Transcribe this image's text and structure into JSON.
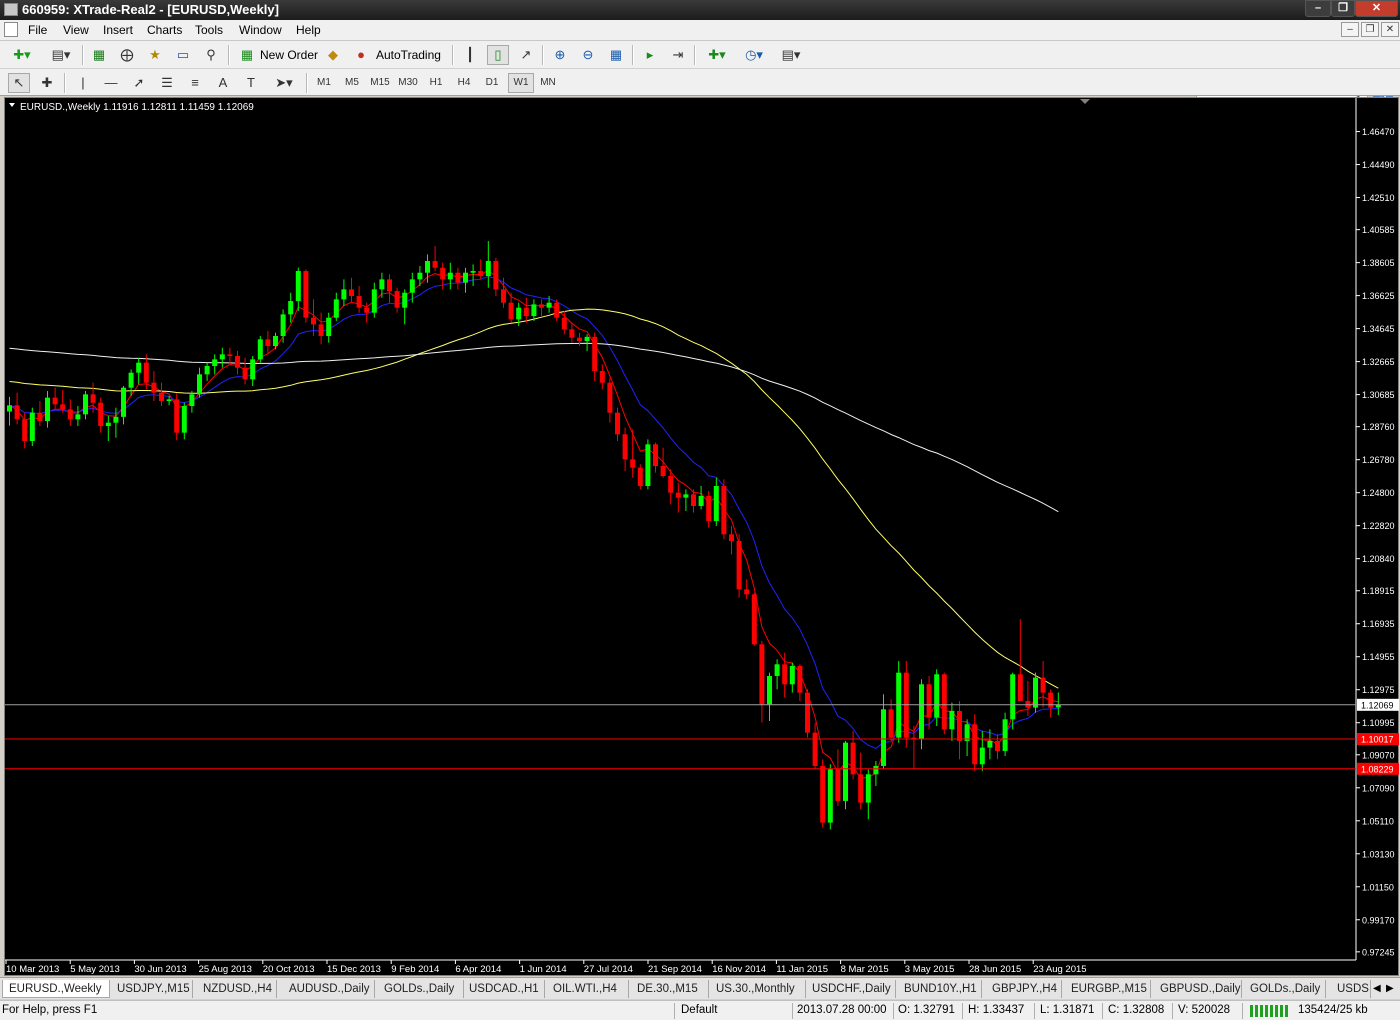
{
  "window": {
    "title": "660959: XTrade-Real2 - [EURUSD,Weekly]"
  },
  "menu": {
    "items": [
      "File",
      "View",
      "Insert",
      "Charts",
      "Tools",
      "Window",
      "Help"
    ]
  },
  "toolbar": {
    "new_order_label": "New Order",
    "autotrading_label": "AutoTrading"
  },
  "timeframes": [
    "M1",
    "M5",
    "M15",
    "M30",
    "H1",
    "H4",
    "D1",
    "W1",
    "MN"
  ],
  "active_timeframe": "W1",
  "chart": {
    "header": "EURUSD.,Weekly  1.11916 1.12811 1.11459 1.12069",
    "background": "#000000",
    "bull_color": "#00ff00",
    "bear_color": "#ff0000"
  },
  "chart_data": {
    "type": "candlestick",
    "symbol": "EURUSD.",
    "timeframe": "Weekly",
    "last_bar": {
      "open": 1.11916,
      "high": 1.12811,
      "low": 1.11459,
      "close": 1.12069
    },
    "y_ticks": [
      "1.46470",
      "1.44490",
      "1.42510",
      "1.40585",
      "1.38605",
      "1.36625",
      "1.34645",
      "1.32665",
      "1.30685",
      "1.28760",
      "1.26780",
      "1.24800",
      "1.22820",
      "1.20840",
      "1.18915",
      "1.16935",
      "1.14955",
      "1.12975",
      "1.10995",
      "1.09070",
      "1.07090",
      "1.05110",
      "1.03130",
      "1.01150",
      "0.99170",
      "0.97245"
    ],
    "ylim": [
      0.96815,
      1.48484
    ],
    "x_ticks": [
      "10 Mar 2013",
      "5 May 2013",
      "30 Jun 2013",
      "25 Aug 2013",
      "20 Oct 2013",
      "15 Dec 2013",
      "9 Feb 2014",
      "6 Apr 2014",
      "1 Jun 2014",
      "27 Jul 2014",
      "21 Sep 2014",
      "16 Nov 2014",
      "11 Jan 2015",
      "8 Mar 2015",
      "3 May 2015",
      "28 Jun 2015",
      "23 Aug 2015"
    ],
    "price_lines": [
      {
        "value": "1.12069",
        "color": "#a0a0a0",
        "label_bg": "#ffffff",
        "label_color": "#000000"
      },
      {
        "value": "1.10017",
        "color": "#ff0000",
        "label_bg": "#ff0000",
        "label_color": "#ffffff"
      },
      {
        "value": "1.08229",
        "color": "#ff0000",
        "label_bg": "#ff0000",
        "label_color": "#ffffff"
      }
    ],
    "moving_averages": [
      {
        "color": "#ff0000"
      },
      {
        "color": "#2222ff"
      },
      {
        "color": "#ffff66"
      },
      {
        "color": "#f0f0f0"
      }
    ],
    "candles": [
      [
        1.2967,
        1.3055,
        1.2882,
        1.3004
      ],
      [
        1.3004,
        1.308,
        1.289,
        1.292
      ],
      [
        1.292,
        1.296,
        1.2745,
        1.279
      ],
      [
        1.279,
        1.299,
        1.276,
        1.296
      ],
      [
        1.296,
        1.303,
        1.288,
        1.291
      ],
      [
        1.291,
        1.309,
        1.287,
        1.305
      ],
      [
        1.305,
        1.311,
        1.298,
        1.301
      ],
      [
        1.301,
        1.3095,
        1.296,
        1.298
      ],
      [
        1.298,
        1.304,
        1.288,
        1.292
      ],
      [
        1.292,
        1.3,
        1.288,
        1.295
      ],
      [
        1.295,
        1.309,
        1.292,
        1.307
      ],
      [
        1.307,
        1.314,
        1.296,
        1.302
      ],
      [
        1.302,
        1.305,
        1.284,
        1.288
      ],
      [
        1.288,
        1.294,
        1.279,
        1.29
      ],
      [
        1.29,
        1.299,
        1.281,
        1.2935
      ],
      [
        1.2935,
        1.312,
        1.289,
        1.311
      ],
      [
        1.311,
        1.322,
        1.306,
        1.32
      ],
      [
        1.32,
        1.329,
        1.313,
        1.326
      ],
      [
        1.326,
        1.331,
        1.31,
        1.314
      ],
      [
        1.314,
        1.321,
        1.303,
        1.308
      ],
      [
        1.308,
        1.314,
        1.3,
        1.303
      ],
      [
        1.303,
        1.306,
        1.3005,
        1.304
      ],
      [
        1.304,
        1.3075,
        1.2795,
        1.284
      ],
      [
        1.284,
        1.302,
        1.28,
        1.3
      ],
      [
        1.3,
        1.309,
        1.296,
        1.307
      ],
      [
        1.307,
        1.323,
        1.305,
        1.319
      ],
      [
        1.319,
        1.326,
        1.315,
        1.324
      ],
      [
        1.324,
        1.331,
        1.319,
        1.328
      ],
      [
        1.328,
        1.335,
        1.323,
        1.331
      ],
      [
        1.331,
        1.335,
        1.325,
        1.33
      ],
      [
        1.33,
        1.333,
        1.319,
        1.323
      ],
      [
        1.323,
        1.329,
        1.313,
        1.316
      ],
      [
        1.316,
        1.33,
        1.312,
        1.328
      ],
      [
        1.328,
        1.342,
        1.326,
        1.34
      ],
      [
        1.34,
        1.345,
        1.331,
        1.336
      ],
      [
        1.336,
        1.344,
        1.334,
        1.342
      ],
      [
        1.342,
        1.358,
        1.338,
        1.355
      ],
      [
        1.355,
        1.368,
        1.35,
        1.363
      ],
      [
        1.363,
        1.383,
        1.357,
        1.381
      ],
      [
        1.381,
        1.382,
        1.35,
        1.353
      ],
      [
        1.353,
        1.364,
        1.342,
        1.349
      ],
      [
        1.349,
        1.356,
        1.337,
        1.342
      ],
      [
        1.342,
        1.356,
        1.338,
        1.353
      ],
      [
        1.353,
        1.368,
        1.351,
        1.364
      ],
      [
        1.364,
        1.376,
        1.36,
        1.37
      ],
      [
        1.37,
        1.377,
        1.362,
        1.366
      ],
      [
        1.366,
        1.372,
        1.356,
        1.359
      ],
      [
        1.359,
        1.362,
        1.35,
        1.356
      ],
      [
        1.356,
        1.374,
        1.353,
        1.37
      ],
      [
        1.37,
        1.38,
        1.365,
        1.376
      ],
      [
        1.376,
        1.379,
        1.362,
        1.369
      ],
      [
        1.369,
        1.371,
        1.356,
        1.359
      ],
      [
        1.359,
        1.37,
        1.349,
        1.368
      ],
      [
        1.368,
        1.38,
        1.362,
        1.376
      ],
      [
        1.376,
        1.384,
        1.372,
        1.38
      ],
      [
        1.38,
        1.391,
        1.374,
        1.387
      ],
      [
        1.387,
        1.396,
        1.381,
        1.383
      ],
      [
        1.383,
        1.386,
        1.37,
        1.376
      ],
      [
        1.376,
        1.386,
        1.37,
        1.38
      ],
      [
        1.38,
        1.383,
        1.37,
        1.374
      ],
      [
        1.374,
        1.383,
        1.368,
        1.38
      ],
      [
        1.38,
        1.385,
        1.372,
        1.381
      ],
      [
        1.381,
        1.388,
        1.376,
        1.378
      ],
      [
        1.378,
        1.399,
        1.371,
        1.387
      ],
      [
        1.387,
        1.389,
        1.366,
        1.37
      ],
      [
        1.37,
        1.377,
        1.359,
        1.362
      ],
      [
        1.362,
        1.368,
        1.35,
        1.352
      ],
      [
        1.352,
        1.362,
        1.348,
        1.359
      ],
      [
        1.359,
        1.365,
        1.35,
        1.354
      ],
      [
        1.354,
        1.364,
        1.351,
        1.361
      ],
      [
        1.361,
        1.364,
        1.354,
        1.359
      ],
      [
        1.359,
        1.366,
        1.356,
        1.362
      ],
      [
        1.362,
        1.364,
        1.351,
        1.353
      ],
      [
        1.353,
        1.357,
        1.343,
        1.346
      ],
      [
        1.346,
        1.35,
        1.338,
        1.341
      ],
      [
        1.341,
        1.344,
        1.336,
        1.339
      ],
      [
        1.339,
        1.343,
        1.333,
        1.3415
      ],
      [
        1.3415,
        1.344,
        1.315,
        1.321
      ],
      [
        1.321,
        1.325,
        1.31,
        1.314
      ],
      [
        1.314,
        1.317,
        1.29,
        1.296
      ],
      [
        1.296,
        1.299,
        1.279,
        1.283
      ],
      [
        1.283,
        1.287,
        1.261,
        1.268
      ],
      [
        1.268,
        1.286,
        1.257,
        1.263
      ],
      [
        1.263,
        1.265,
        1.25,
        1.252
      ],
      [
        1.252,
        1.28,
        1.25,
        1.277
      ],
      [
        1.277,
        1.278,
        1.26,
        1.264
      ],
      [
        1.264,
        1.275,
        1.257,
        1.258
      ],
      [
        1.258,
        1.262,
        1.241,
        1.248
      ],
      [
        1.248,
        1.254,
        1.236,
        1.245
      ],
      [
        1.245,
        1.25,
        1.237,
        1.247
      ],
      [
        1.247,
        1.25,
        1.236,
        1.24
      ],
      [
        1.24,
        1.252,
        1.238,
        1.246
      ],
      [
        1.246,
        1.249,
        1.227,
        1.231
      ],
      [
        1.231,
        1.257,
        1.228,
        1.252
      ],
      [
        1.252,
        1.256,
        1.22,
        1.223
      ],
      [
        1.223,
        1.228,
        1.211,
        1.219
      ],
      [
        1.219,
        1.223,
        1.185,
        1.19
      ],
      [
        1.19,
        1.196,
        1.184,
        1.187
      ],
      [
        1.187,
        1.188,
        1.156,
        1.157
      ],
      [
        1.157,
        1.159,
        1.11,
        1.121
      ],
      [
        1.121,
        1.14,
        1.111,
        1.138
      ],
      [
        1.138,
        1.148,
        1.13,
        1.145
      ],
      [
        1.145,
        1.152,
        1.125,
        1.133
      ],
      [
        1.133,
        1.146,
        1.128,
        1.144
      ],
      [
        1.144,
        1.145,
        1.123,
        1.128
      ],
      [
        1.128,
        1.13,
        1.101,
        1.104
      ],
      [
        1.104,
        1.11,
        1.082,
        1.084
      ],
      [
        1.084,
        1.088,
        1.047,
        1.05
      ],
      [
        1.05,
        1.085,
        1.046,
        1.082
      ],
      [
        1.082,
        1.094,
        1.06,
        1.063
      ],
      [
        1.063,
        1.099,
        1.058,
        1.098
      ],
      [
        1.098,
        1.105,
        1.076,
        1.079
      ],
      [
        1.079,
        1.092,
        1.058,
        1.062
      ],
      [
        1.062,
        1.082,
        1.052,
        1.079
      ],
      [
        1.079,
        1.087,
        1.072,
        1.084
      ],
      [
        1.084,
        1.127,
        1.082,
        1.118
      ],
      [
        1.118,
        1.124,
        1.099,
        1.101
      ],
      [
        1.101,
        1.147,
        1.098,
        1.14
      ],
      [
        1.14,
        1.147,
        1.095,
        1.101
      ],
      [
        1.101,
        1.108,
        1.082,
        1.1
      ],
      [
        1.1,
        1.136,
        1.094,
        1.133
      ],
      [
        1.133,
        1.138,
        1.106,
        1.113
      ],
      [
        1.113,
        1.142,
        1.108,
        1.139
      ],
      [
        1.139,
        1.14,
        1.103,
        1.106
      ],
      [
        1.106,
        1.122,
        1.099,
        1.117
      ],
      [
        1.117,
        1.123,
        1.088,
        1.099
      ],
      [
        1.099,
        1.112,
        1.09,
        1.109
      ],
      [
        1.109,
        1.115,
        1.081,
        1.085
      ],
      [
        1.085,
        1.105,
        1.081,
        1.095
      ],
      [
        1.095,
        1.106,
        1.088,
        1.099
      ],
      [
        1.099,
        1.103,
        1.088,
        1.093
      ],
      [
        1.093,
        1.116,
        1.09,
        1.112
      ],
      [
        1.112,
        1.14,
        1.106,
        1.139
      ],
      [
        1.139,
        1.172,
        1.133,
        1.123
      ],
      [
        1.123,
        1.135,
        1.114,
        1.119
      ],
      [
        1.119,
        1.14,
        1.116,
        1.137
      ],
      [
        1.137,
        1.147,
        1.119,
        1.128
      ],
      [
        1.128,
        1.13,
        1.113,
        1.119
      ],
      [
        1.11916,
        1.12811,
        1.11459,
        1.12069
      ]
    ]
  },
  "symbol_tabs": [
    "EURUSD.,Weekly",
    "USDJPY.,M15",
    "NZDUSD.,H4",
    "AUDUSD.,Daily",
    "GOLDs.,Daily",
    "USDCAD.,H1",
    "OIL.WTI.,H4",
    "DE.30.,M15",
    "US.30.,Monthly",
    "USDCHF.,Daily",
    "BUND10Y.,H1",
    "GBPJPY.,H4",
    "EURGBP.,M15",
    "GBPUSD.,Daily",
    "GOLDs.,Daily",
    "USDS"
  ],
  "status": {
    "help": "For Help, press F1",
    "profile": "Default",
    "datetime": "2013.07.28 00:00",
    "open": "O: 1.32791",
    "high": "H: 1.33437",
    "low": "L: 1.31871",
    "close": "C: 1.32808",
    "volume": "V: 520028",
    "traffic": "135424/25 kb"
  }
}
